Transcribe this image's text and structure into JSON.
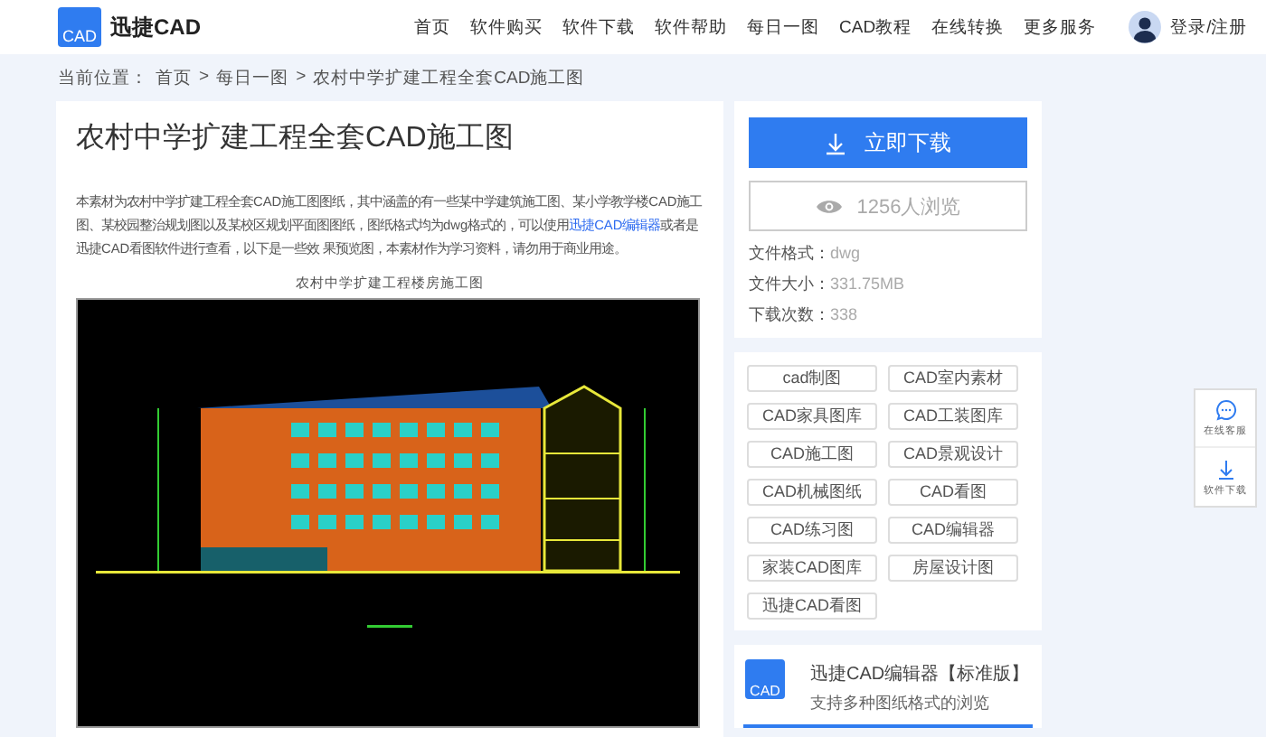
{
  "header": {
    "logo_text": "CAD",
    "brand": "迅捷CAD",
    "nav": [
      "首页",
      "软件购买",
      "软件下载",
      "软件帮助",
      "每日一图",
      "CAD教程",
      "在线转换",
      "更多服务"
    ],
    "login": "登录/注册"
  },
  "breadcrumb": {
    "label": "当前位置：",
    "items": [
      "首页",
      "每日一图",
      "农村中学扩建工程全套CAD施工图"
    ],
    "separator": ">"
  },
  "article": {
    "title": "农村中学扩建工程全套CAD施工图",
    "description": {
      "before": "本素材为农村中学扩建工程全套CAD施工图图纸，其中涵盖的有一些某中学建筑施工图、某小学教学楼CAD施工图、某校园整治规划图以及某校区规划平面图图纸，图纸格式均为dwg格式的，可以使用",
      "link": "迅捷CAD编辑器",
      "after": "或者是迅捷CAD看图软件进行查看，以下是一些效 果预览图，本素材作为学习资料，请勿用于商业用途。"
    },
    "figure_caption": "农村中学扩建工程楼房施工图"
  },
  "download": {
    "button": "立即下载",
    "views": "1256人浏览",
    "info": [
      {
        "label": "文件格式：",
        "value": "dwg"
      },
      {
        "label": "文件大小：",
        "value": "331.75MB"
      },
      {
        "label": "下载次数：",
        "value": "338"
      }
    ]
  },
  "tags": [
    "cad制图",
    "CAD室内素材",
    "CAD家具图库",
    "CAD工装图库",
    "CAD施工图",
    "CAD景观设计",
    "CAD机械图纸",
    "CAD看图",
    "CAD练习图",
    "CAD编辑器",
    "家装CAD图库",
    "房屋设计图",
    "迅捷CAD看图"
  ],
  "product": {
    "logo_text": "CAD",
    "title": "迅捷CAD编辑器【标准版】",
    "subtitle": "支持多种图纸格式的浏览"
  },
  "float_widget": [
    {
      "kind": "chat",
      "label": "在线客服"
    },
    {
      "kind": "download",
      "label": "软件下载"
    }
  ]
}
